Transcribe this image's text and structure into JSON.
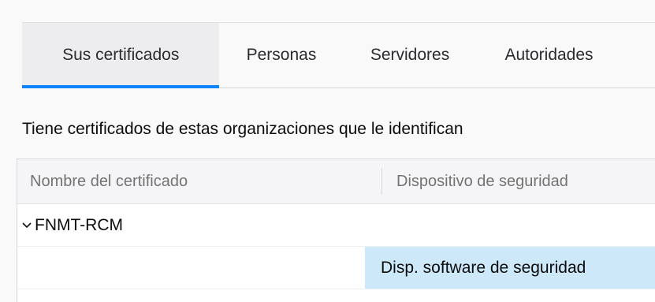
{
  "tabs": [
    {
      "label": "Sus certificados",
      "active": true
    },
    {
      "label": "Personas",
      "active": false
    },
    {
      "label": "Servidores",
      "active": false
    },
    {
      "label": "Autoridades",
      "active": false
    }
  ],
  "description": "Tiene certificados de estas organizaciones que le identifican",
  "table": {
    "columns": [
      "Nombre del certificado",
      "Dispositivo de seguridad"
    ],
    "groups": [
      {
        "name": "FNMT-RCM",
        "expanded": true,
        "rows": [
          {
            "name": "",
            "device": "Disp. software de seguridad",
            "selected": true
          }
        ]
      }
    ]
  },
  "colors": {
    "accent": "#0a84ff",
    "selected_row": "#cde8f8",
    "active_tab_bg": "#ededf0"
  },
  "icons": {
    "group_toggle": "chevron-down-icon"
  }
}
